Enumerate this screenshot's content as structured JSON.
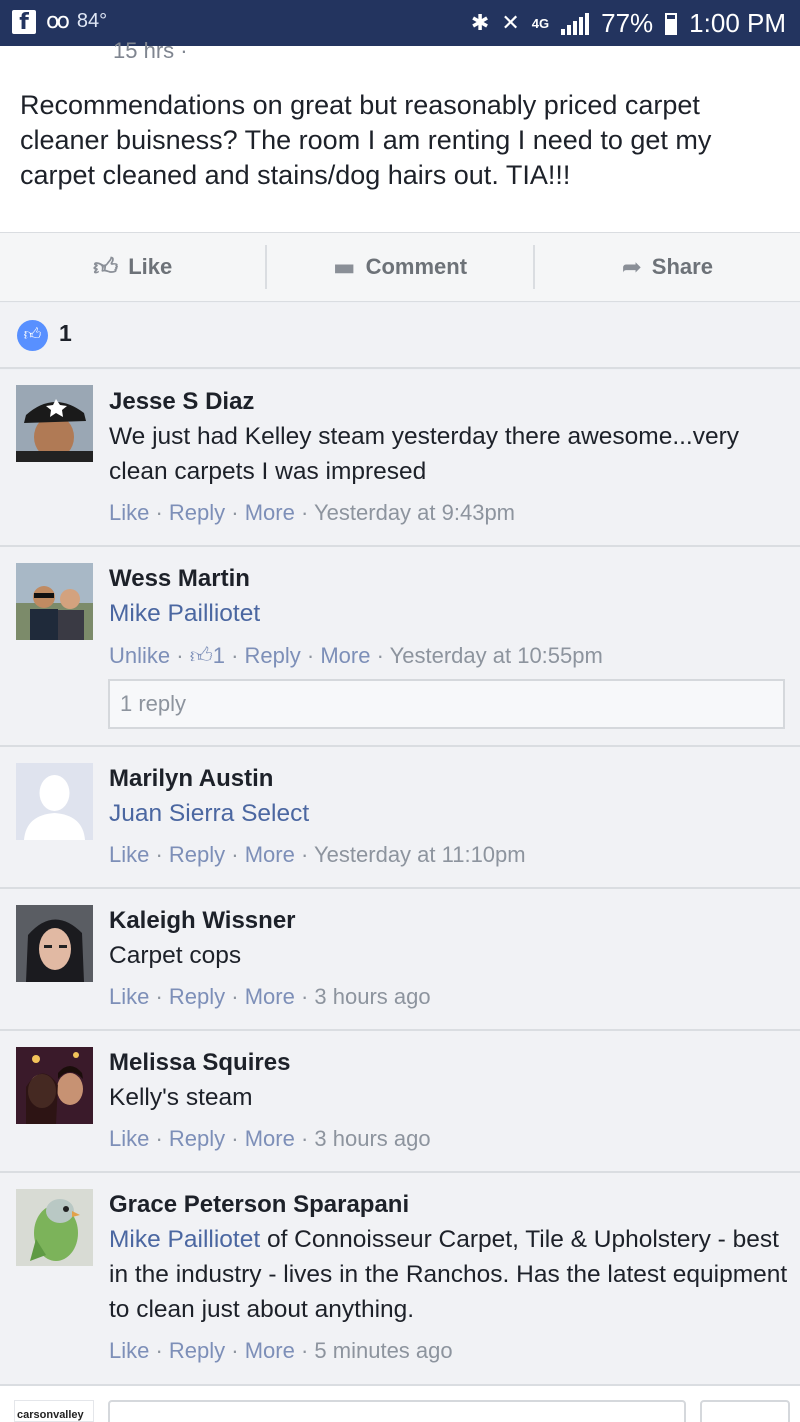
{
  "status_bar": {
    "temperature": "84°",
    "network": "4G",
    "battery": "77%",
    "time": "1:00 PM"
  },
  "post": {
    "time_fragment": "15 hrs ·",
    "text": "Recommendations on great but reasonably priced carpet cleaner buisness? The room I am renting I need to get my carpet cleaned and stains/dog hairs out. TIA!!!"
  },
  "actions": {
    "like": "Like",
    "comment": "Comment",
    "share": "Share"
  },
  "likes": {
    "count": "1"
  },
  "comments": [
    {
      "name": "Jesse S Diaz",
      "text": "We just had Kelley steam yesterday there awesome...very clean carpets I was impresed",
      "like": "Like",
      "reply": "Reply",
      "more": "More",
      "time": "Yesterday at 9:43pm"
    },
    {
      "name": "Wess Martin",
      "tag": "Mike Pailliotet",
      "unlike": "Unlike",
      "reactions": "1",
      "reply": "Reply",
      "more": "More",
      "time": "Yesterday at 10:55pm",
      "replies": "1 reply"
    },
    {
      "name": "Marilyn Austin",
      "tag": "Juan Sierra Select",
      "like": "Like",
      "reply": "Reply",
      "more": "More",
      "time": "Yesterday at 11:10pm"
    },
    {
      "name": "Kaleigh Wissner",
      "text": "Carpet cops",
      "like": "Like",
      "reply": "Reply",
      "more": "More",
      "time": "3 hours ago"
    },
    {
      "name": "Melissa Squires",
      "text": "Kelly's steam",
      "like": "Like",
      "reply": "Reply",
      "more": "More",
      "time": "3 hours ago"
    },
    {
      "name": "Grace Peterson Sparapani",
      "tag": "Mike Pailliotet",
      "text": " of Connoisseur Carpet, Tile & Upholstery - best in the industry - lives in the Ranchos. Has the latest equipment to clean just about anything.",
      "like": "Like",
      "reply": "Reply",
      "more": "More",
      "time": "5 minutes ago"
    }
  ],
  "composer": {
    "avatar_label": "carsonvalley"
  },
  "colors": {
    "status_bar": "#23345f",
    "link": "#4b67a1",
    "like_badge": "#5890ff"
  }
}
